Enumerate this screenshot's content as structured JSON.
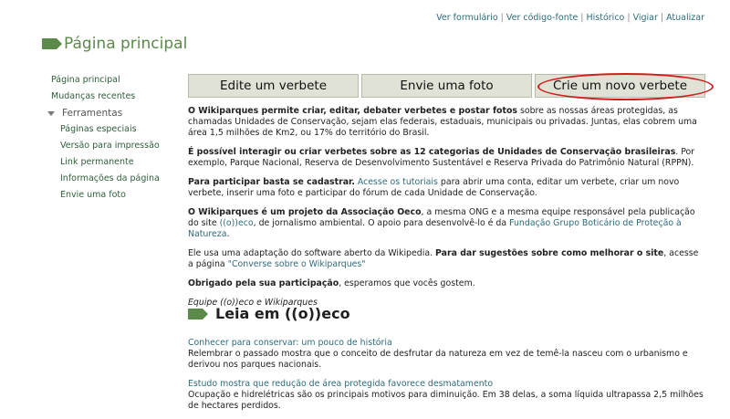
{
  "top_links": [
    "Ver formulário",
    "Ver código-fonte",
    "Histórico",
    "Vigiar",
    "Atualizar"
  ],
  "page_title": "Página principal",
  "sidebar": {
    "items": [
      "Página principal",
      "Mudanças recentes"
    ],
    "group_label": "Ferramentas",
    "sub_items": [
      "Páginas especiais",
      "Versão para impressão",
      "Link permanente",
      "Informações da página",
      "Envie uma foto"
    ]
  },
  "buttons": [
    "Edite um verbete",
    "Envie uma foto",
    "Crie um novo verbete"
  ],
  "paragraphs": {
    "p1_bold": "O Wikiparques permite criar, editar, debater verbetes e postar fotos",
    "p1_rest": " sobre as nossas áreas protegidas, as chamadas Unidades de Conservação, sejam elas federais, estaduais, municipais ou privadas. Juntas, elas cobrem uma área 1,5 milhões de Km2, ou 17% do território do Brasil.",
    "p2_bold": "É possível interagir ou criar verbetes sobre as 12 categorias de Unidades de Conservação brasileiras",
    "p2_rest": ". Por exemplo, Parque Nacional, Reserva de Desenvolvimento Sustentável e Reserva Privada do Patrimônio Natural (RPPN).",
    "p3_bold": "Para participar basta se cadastrar.",
    "p3_link": "Acesse os tutoriais",
    "p3_rest": " para abrir uma conta, editar um verbete, criar um novo verbete, inserir uma foto e participar do fórum de cada Unidade de Conservação.",
    "p4_bold": "O Wikiparques é um projeto da Associação Oeco",
    "p4_mid": ", a mesma ONG e a mesma equipe responsável pela publicação do site ",
    "p4_link1": "((o))eco",
    "p4_mid2": ", de jornalismo ambiental. O apoio para desenvolvê-lo é da ",
    "p4_link2": "Fundação Grupo Boticário de Proteção à Natureza",
    "p4_end": ".",
    "p5_start": "Ele usa uma adaptação do software aberto da Wikipedia. ",
    "p5_bold": "Para dar sugestões sobre como melhorar o site",
    "p5_mid": ", acesse a página ",
    "p5_link": "\"Converse sobre o Wikiparques\"",
    "p6_bold": "Obrigado pela sua participação",
    "p6_rest": ", esperamos que vocês gostem.",
    "p7_italic": "Equipe ((o))eco e Wikiparques"
  },
  "section_title": "Leia em ((o))eco",
  "news": [
    {
      "link": "Conhecer para conservar: um pouco de história",
      "text": "Relembrar o passado mostra que o conceito de desfrutar da natureza em vez de temê-la nasceu com o urbanismo e derivou nos parques nacionais."
    },
    {
      "link": "Estudo mostra que redução de área protegida favorece desmatamento",
      "text": "Ocupação e hidrelétricas são os principais motivos para diminuição. Em 38 delas, a soma líquida ultrapassa 2,5 milhões de hectares perdidos."
    }
  ],
  "colors": {
    "accent_green": "#5b8a4a",
    "link": "#2d6b7a",
    "button_bg": "#dfe2d4",
    "highlight_circle": "#d11d1d"
  }
}
